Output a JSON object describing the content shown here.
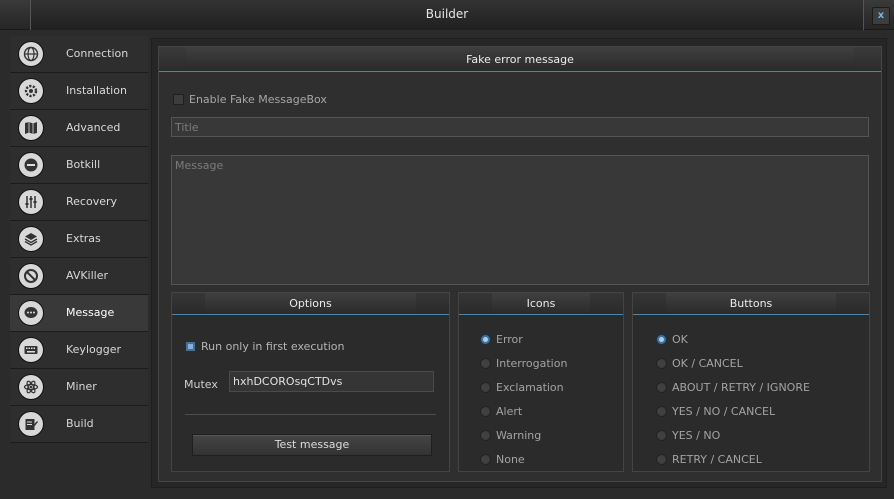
{
  "window": {
    "title": "Builder",
    "close_label": "x"
  },
  "sidebar": {
    "items": [
      {
        "label": "Connection",
        "icon": "globe-icon"
      },
      {
        "label": "Installation",
        "icon": "gear-icon"
      },
      {
        "label": "Advanced",
        "icon": "map-icon"
      },
      {
        "label": "Botkill",
        "icon": "minus-circle-icon"
      },
      {
        "label": "Recovery",
        "icon": "sliders-icon"
      },
      {
        "label": "Extras",
        "icon": "layers-icon"
      },
      {
        "label": "AVKiller",
        "icon": "block-icon"
      },
      {
        "label": "Message",
        "icon": "chat-bubble-icon"
      },
      {
        "label": "Keylogger",
        "icon": "keyboard-icon"
      },
      {
        "label": "Miner",
        "icon": "atom-icon"
      },
      {
        "label": "Build",
        "icon": "edit-icon"
      }
    ],
    "active_index": 7
  },
  "panel": {
    "header": "Fake error message",
    "enable_label": "Enable Fake MessageBox",
    "enable_checked": false,
    "title_placeholder": "Title",
    "message_placeholder": "Message"
  },
  "options": {
    "header": "Options",
    "run_first_label": "Run only in first execution",
    "run_first_checked": true,
    "mutex_label": "Mutex",
    "mutex_value": "hxhDCOROsqCTDvs",
    "test_button": "Test message"
  },
  "icons": {
    "header": "Icons",
    "options": [
      "Error",
      "Interrogation",
      "Exclamation",
      "Alert",
      "Warning",
      "None"
    ],
    "selected": 0
  },
  "buttons": {
    "header": "Buttons",
    "options": [
      "OK",
      "OK / CANCEL",
      "ABOUT / RETRY / IGNORE",
      "YES / NO / CANCEL",
      "YES / NO",
      "RETRY / CANCEL"
    ],
    "selected": 0
  },
  "colors": {
    "accent": "#4b86b0",
    "close_x": "#6fb7e9"
  }
}
